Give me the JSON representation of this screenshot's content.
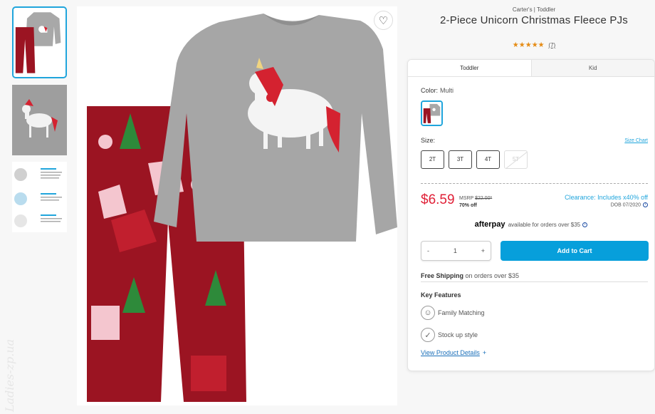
{
  "product": {
    "brand": "Carter's | Toddler",
    "title": "2-Piece Unicorn Christmas Fleece PJs",
    "stars": "★★★★★",
    "review_count": "(7)",
    "rating": 5
  },
  "favorite": {
    "icon": "heart-icon",
    "glyph": "♡"
  },
  "tabs": [
    {
      "label": "Toddler",
      "active": true
    },
    {
      "label": "Kid",
      "active": false
    }
  ],
  "color": {
    "label": "Color:",
    "value": "Multi"
  },
  "size": {
    "label": "Size:",
    "chart_link": "Size Chart",
    "options": [
      {
        "label": "2T",
        "available": true
      },
      {
        "label": "3T",
        "available": true
      },
      {
        "label": "4T",
        "available": true
      },
      {
        "label": "5T",
        "available": false
      }
    ]
  },
  "pricing": {
    "price": "$6.59",
    "msrp_label": "MSRP",
    "msrp_value": "$22.00*",
    "percent_off": "70% off",
    "clearance": "Clearance: Includes x40% off",
    "dob": "DOB 07/2020",
    "info_glyph": "i"
  },
  "afterpay": {
    "logo": "afterpay",
    "text": "available for orders over $35",
    "info_glyph": "i"
  },
  "quantity": {
    "value": "1",
    "minus": "-",
    "plus": "+"
  },
  "cart": {
    "label": "Add to Cart"
  },
  "shipping": {
    "bold": "Free Shipping",
    "text": " on orders over $35"
  },
  "features": {
    "title": "Key Features",
    "items": [
      {
        "label": "Family Matching",
        "icon": "family-icon"
      },
      {
        "label": "Stock up style",
        "icon": "checkmark-icon"
      }
    ]
  },
  "details": {
    "label": "View Product Details",
    "plus": "+"
  },
  "watermark": "Ladies-zp.ua",
  "colors": {
    "accent": "#079fdb",
    "price": "#e02037",
    "rating": "#e58b14",
    "pant_red": "#9b1422",
    "shirt_gray": "#a6a6a6"
  }
}
